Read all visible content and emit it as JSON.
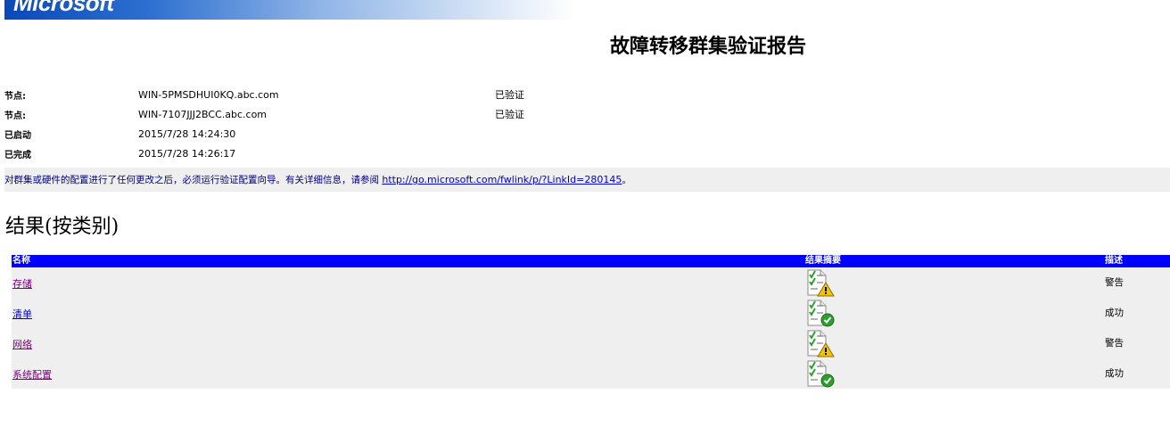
{
  "brand": {
    "logo_text": "Microsoft"
  },
  "report": {
    "title": "故障转移群集验证报告"
  },
  "info": [
    {
      "label": "节点:",
      "value": "WIN-5PMSDHUI0KQ.abc.com",
      "status": "已验证"
    },
    {
      "label": "节点:",
      "value": "WIN-7107JJJ2BCC.abc.com",
      "status": "已验证"
    },
    {
      "label": "已启动",
      "value": "2015/7/28 14:24:30",
      "status": ""
    },
    {
      "label": "已完成",
      "value": "2015/7/28 14:26:17",
      "status": ""
    }
  ],
  "notice": {
    "text": "对群集或硬件的配置进行了任何更改之后，必须运行验证配置向导。有关详细信息，请参阅 ",
    "link": "http://go.microsoft.com/fwlink/p/?LinkId=280145",
    "suffix": "。"
  },
  "results": {
    "section_title": "结果(按类别)",
    "headers": {
      "name": "名称",
      "summary": "结果摘要",
      "description": "描述"
    },
    "rows": [
      {
        "name": "存储",
        "icon": "warning-icon",
        "description": "警告"
      },
      {
        "name": "清单",
        "icon": "success-icon",
        "description": "成功"
      },
      {
        "name": "网络",
        "icon": "warning-icon",
        "description": "警告"
      },
      {
        "name": "系统配置",
        "icon": "success-icon",
        "description": "成功"
      }
    ]
  },
  "colors": {
    "header_bg": "#0000ff",
    "row_bg": "#efefef",
    "visited_link": "#800080",
    "link": "#0000cc",
    "warning": "#f5c400",
    "success": "#2e9e2e"
  }
}
